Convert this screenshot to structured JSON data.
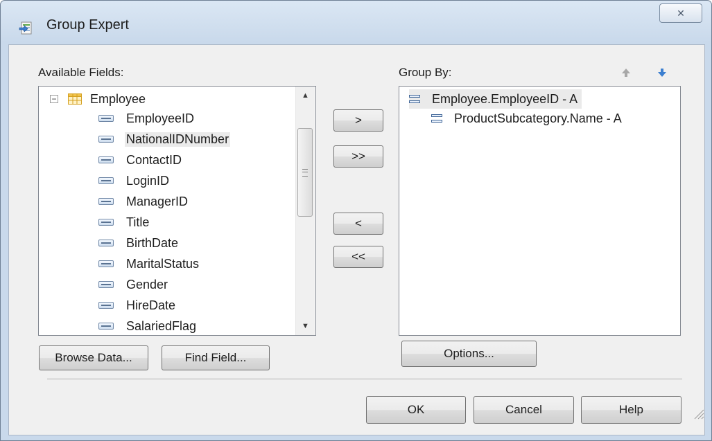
{
  "window": {
    "title": "Group Expert",
    "close_glyph": "✕"
  },
  "available": {
    "label": "Available Fields:",
    "table": {
      "expand_glyph": "−",
      "name": "Employee"
    },
    "fields": [
      "EmployeeID",
      "NationalIDNumber",
      "ContactID",
      "LoginID",
      "ManagerID",
      "Title",
      "BirthDate",
      "MaritalStatus",
      "Gender",
      "HireDate",
      "SalariedFlag"
    ],
    "selected_field": "NationalIDNumber"
  },
  "transfer": {
    "add": ">",
    "add_all": ">>",
    "remove": "<",
    "remove_all": "<<"
  },
  "group_by": {
    "label": "Group By:",
    "items": [
      "Employee.EmployeeID - A",
      "ProductSubcategory.Name - A"
    ]
  },
  "buttons": {
    "browse": "Browse Data...",
    "find": "Find Field...",
    "options": "Options...",
    "ok": "OK",
    "cancel": "Cancel",
    "help": "Help"
  },
  "colors": {
    "accent": "#3c7fd0",
    "title_bar": "#dbe7f4",
    "client": "#f0f0f0"
  }
}
